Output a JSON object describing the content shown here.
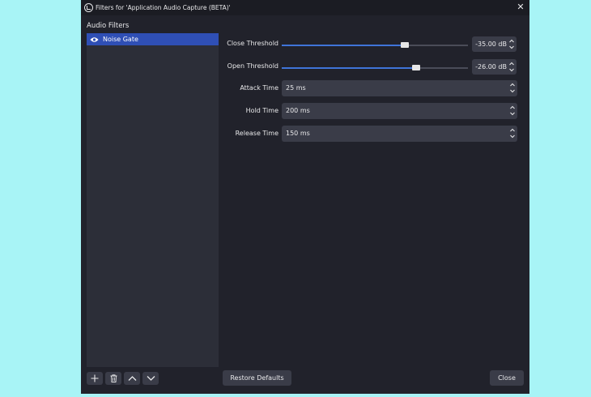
{
  "window": {
    "title": "Filters for 'Application Audio Capture (BETA)'",
    "close_icon": "close-icon"
  },
  "sidebar": {
    "heading": "Audio Filters",
    "items": [
      {
        "label": "Noise Gate",
        "icon": "eye-icon",
        "selected": true
      }
    ],
    "buttons": [
      "add-icon",
      "trash-icon",
      "arrow-up-icon",
      "arrow-down-icon"
    ]
  },
  "settings": {
    "close_threshold": {
      "label": "Close Threshold",
      "value": "-35.00 dB",
      "level": 0.66
    },
    "open_threshold": {
      "label": "Open Threshold",
      "value": "-26.00 dB",
      "level": 0.72
    },
    "attack_time": {
      "label": "Attack Time",
      "value": "25 ms"
    },
    "hold_time": {
      "label": "Hold Time",
      "value": "200 ms"
    },
    "release_time": {
      "label": "Release Time",
      "value": "150 ms"
    }
  },
  "footer": {
    "restore_label": "Restore Defaults",
    "close_label": "Close"
  },
  "colors": {
    "accent": "#3f74d9",
    "selection": "#2f4fb5",
    "background": "#21222b",
    "desktop": "#a8f4f6"
  }
}
